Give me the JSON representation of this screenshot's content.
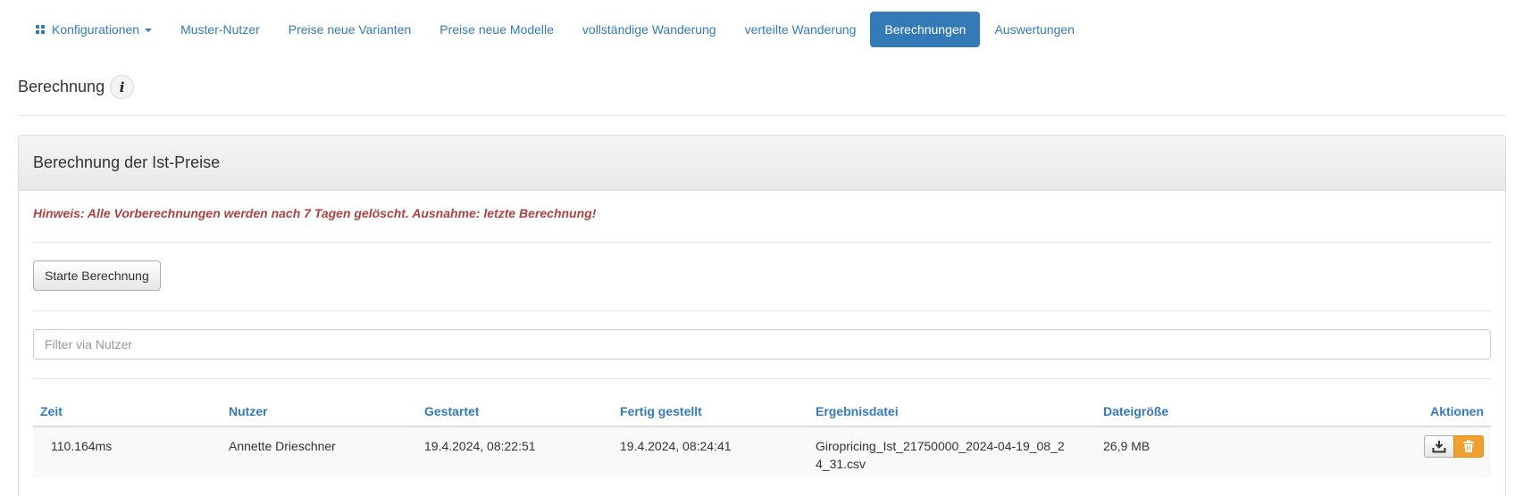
{
  "nav": {
    "items": [
      {
        "label": "Konfigurationen",
        "active": false,
        "dropdown": true
      },
      {
        "label": "Muster-Nutzer",
        "active": false
      },
      {
        "label": "Preise neue Varianten",
        "active": false
      },
      {
        "label": "Preise neue Modelle",
        "active": false
      },
      {
        "label": "vollständige Wanderung",
        "active": false
      },
      {
        "label": "verteilte Wanderung",
        "active": false
      },
      {
        "label": "Berechnungen",
        "active": true
      },
      {
        "label": "Auswertungen",
        "active": false
      }
    ]
  },
  "page": {
    "title": "Berechnung",
    "info_icon": "info-icon"
  },
  "panel": {
    "heading": "Berechnung der Ist-Preise",
    "hint": "Hinweis: Alle Vorberechnungen werden nach 7 Tagen gelöscht. Ausnahme: letzte Berechnung!",
    "start_button": "Starte Berechnung",
    "filter_placeholder": "Filter via Nutzer"
  },
  "table": {
    "headers": [
      "Zeit",
      "Nutzer",
      "Gestartet",
      "Fertig gestellt",
      "Ergebnisdatei",
      "Dateigröße",
      "Aktionen"
    ],
    "rows": [
      {
        "zeit": "110.164ms",
        "nutzer": "Annette Drieschner",
        "gestartet": "19.4.2024, 08:22:51",
        "fertig": "19.4.2024, 08:24:41",
        "datei": "Giropricing_Ist_21750000_2024-04-19_08_24_31.csv",
        "groesse": "26,9 MB"
      }
    ]
  },
  "colors": {
    "accent": "#337ab7",
    "warning_text": "#a94442",
    "delete_button": "#f0a030"
  }
}
